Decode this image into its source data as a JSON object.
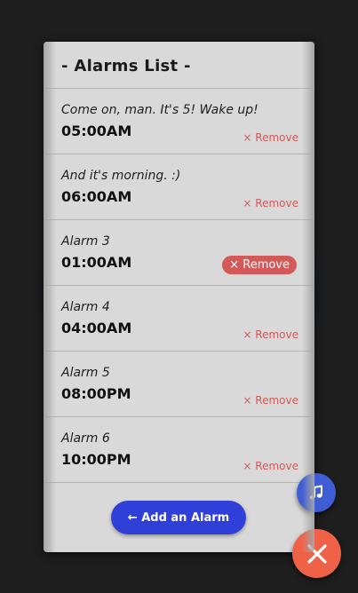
{
  "header": {
    "title": "- Alarms List -"
  },
  "alarms": [
    {
      "name": "Come on, man. It's 5! Wake up!",
      "time": "05:00AM",
      "remove_label": "× Remove"
    },
    {
      "name": "And it's morning. :)",
      "time": "06:00AM",
      "remove_label": "× Remove"
    },
    {
      "name": "Alarm 3",
      "time": "01:00AM",
      "remove_label": "× Remove"
    },
    {
      "name": "Alarm 4",
      "time": "04:00AM",
      "remove_label": "× Remove"
    },
    {
      "name": "Alarm 5",
      "time": "08:00PM",
      "remove_label": "× Remove"
    },
    {
      "name": "Alarm 6",
      "time": "10:00PM",
      "remove_label": "× Remove"
    }
  ],
  "add_button": {
    "label": "← Add an Alarm"
  },
  "fabs": {
    "music_icon": "music-note-icon",
    "close_icon": "close-icon"
  },
  "colors": {
    "accent_blue": "#2f3fd8",
    "remove_red": "#cf5a5a",
    "close_orange": "#ef6248",
    "music_blue": "#3f5ed6"
  }
}
